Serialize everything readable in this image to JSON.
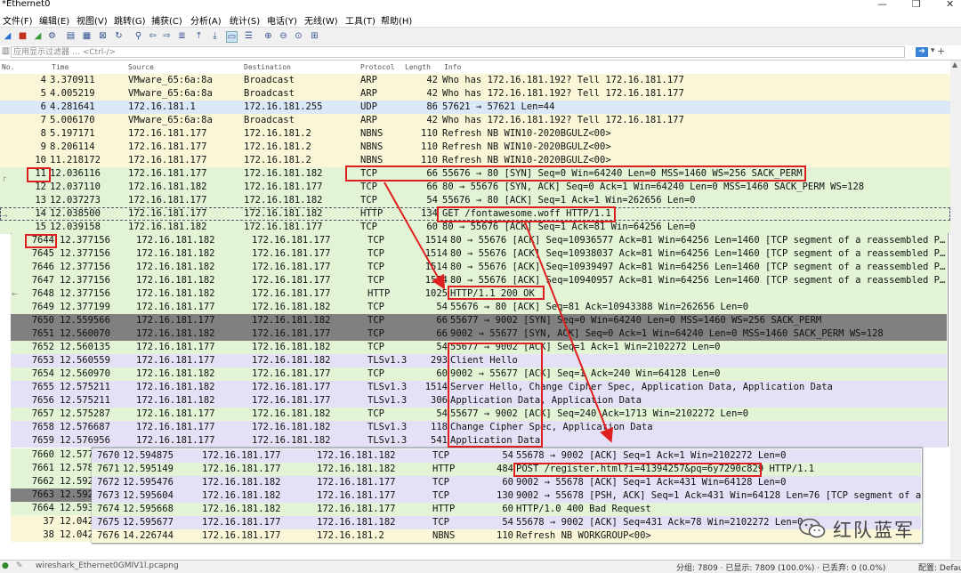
{
  "window": {
    "title": "*Ethernet0"
  },
  "menu": [
    "文件(F)",
    "编辑(E)",
    "视图(V)",
    "跳转(G)",
    "捕获(C)",
    "分析(A)",
    "统计(S)",
    "电话(Y)",
    "无线(W)",
    "工具(T)",
    "帮助(H)"
  ],
  "filter": {
    "placeholder": "应用显示过滤器 … <Ctrl-/>"
  },
  "columns": {
    "no": "No.",
    "time": "Time",
    "src": "Source",
    "dst": "Destination",
    "proto": "Protocol",
    "len": "Length",
    "info": "Info"
  },
  "packets_main": [
    {
      "no": "4",
      "time": "3.370911",
      "src": "VMware_65:6a:8a",
      "dst": "Broadcast",
      "proto": "ARP",
      "len": "42",
      "info": "Who has 172.16.181.192? Tell 172.16.181.177"
    },
    {
      "no": "5",
      "time": "4.005219",
      "src": "VMware_65:6a:8a",
      "dst": "Broadcast",
      "proto": "ARP",
      "len": "42",
      "info": "Who has 172.16.181.192? Tell 172.16.181.177"
    },
    {
      "no": "6",
      "time": "4.281641",
      "src": "172.16.181.1",
      "dst": "172.16.181.255",
      "proto": "UDP",
      "len": "86",
      "info": "57621 → 57621 Len=44"
    },
    {
      "no": "7",
      "time": "5.006170",
      "src": "VMware_65:6a:8a",
      "dst": "Broadcast",
      "proto": "ARP",
      "len": "42",
      "info": "Who has 172.16.181.192? Tell 172.16.181.177"
    },
    {
      "no": "8",
      "time": "5.197171",
      "src": "172.16.181.177",
      "dst": "172.16.181.2",
      "proto": "NBNS",
      "len": "110",
      "info": "Refresh NB WIN10-2020BGULZ<00>"
    },
    {
      "no": "9",
      "time": "8.206114",
      "src": "172.16.181.177",
      "dst": "172.16.181.2",
      "proto": "NBNS",
      "len": "110",
      "info": "Refresh NB WIN10-2020BGULZ<00>"
    },
    {
      "no": "10",
      "time": "11.218172",
      "src": "172.16.181.177",
      "dst": "172.16.181.2",
      "proto": "NBNS",
      "len": "110",
      "info": "Refresh NB WIN10-2020BGULZ<00>"
    },
    {
      "no": "11",
      "time": "12.036116",
      "src": "172.16.181.177",
      "dst": "172.16.181.182",
      "proto": "TCP",
      "len": "66",
      "info": "55676 → 80 [SYN] Seq=0 Win=64240 Len=0 MSS=1460 WS=256 SACK_PERM"
    },
    {
      "no": "12",
      "time": "12.037110",
      "src": "172.16.181.182",
      "dst": "172.16.181.177",
      "proto": "TCP",
      "len": "66",
      "info": "80 → 55676 [SYN, ACK] Seq=0 Ack=1 Win=64240 Len=0 MSS=1460 SACK_PERM WS=128"
    },
    {
      "no": "13",
      "time": "12.037273",
      "src": "172.16.181.177",
      "dst": "172.16.181.182",
      "proto": "TCP",
      "len": "54",
      "info": "55676 → 80 [ACK] Seq=1 Ack=1 Win=262656 Len=0"
    },
    {
      "no": "14",
      "time": "12.038500",
      "src": "172.16.181.177",
      "dst": "172.16.181.182",
      "proto": "HTTP",
      "len": "134",
      "info": "GET /fontawesome.woff HTTP/1.1"
    },
    {
      "no": "15",
      "time": "12.039158",
      "src": "172.16.181.182",
      "dst": "172.16.181.177",
      "proto": "TCP",
      "len": "60",
      "info": "80 → 55676 [ACK] Seq=1 Ack=81 Win=64256 Len=0"
    }
  ],
  "packets_overlay1": [
    {
      "no": "7644",
      "time": "12.377156",
      "src": "172.16.181.182",
      "dst": "172.16.181.177",
      "proto": "TCP",
      "len": "1514",
      "info": "80 → 55676 [ACK] Seq=10936577 Ack=81 Win=64256 Len=1460 [TCP segment of a reassembled P…"
    },
    {
      "no": "7645",
      "time": "12.377156",
      "src": "172.16.181.182",
      "dst": "172.16.181.177",
      "proto": "TCP",
      "len": "1514",
      "info": "80 → 55676 [ACK] Seq=10938037 Ack=81 Win=64256 Len=1460 [TCP segment of a reassembled P…"
    },
    {
      "no": "7646",
      "time": "12.377156",
      "src": "172.16.181.182",
      "dst": "172.16.181.177",
      "proto": "TCP",
      "len": "1514",
      "info": "80 → 55676 [ACK] Seq=10939497 Ack=81 Win=64256 Len=1460 [TCP segment of a reassembled P…"
    },
    {
      "no": "7647",
      "time": "12.377156",
      "src": "172.16.181.182",
      "dst": "172.16.181.177",
      "proto": "TCP",
      "len": "1514",
      "info": "80 → 55676 [ACK] Seq=10940957 Ack=81 Win=64256 Len=1460 [TCP segment of a reassembled P…"
    },
    {
      "no": "7648",
      "time": "12.377156",
      "src": "172.16.181.182",
      "dst": "172.16.181.177",
      "proto": "HTTP",
      "len": "1025",
      "info": "HTTP/1.1 200 OK"
    },
    {
      "no": "7649",
      "time": "12.377199",
      "src": "172.16.181.177",
      "dst": "172.16.181.182",
      "proto": "TCP",
      "len": "54",
      "info": "55676 → 80 [ACK] Seq=81 Ack=10943388 Win=262656 Len=0"
    },
    {
      "no": "7650",
      "time": "12.559566",
      "src": "172.16.181.177",
      "dst": "172.16.181.182",
      "proto": "TCP",
      "len": "66",
      "info": "55677 → 9002 [SYN] Seq=0 Win=64240 Len=0 MSS=1460 WS=256 SACK_PERM"
    },
    {
      "no": "7651",
      "time": "12.560070",
      "src": "172.16.181.182",
      "dst": "172.16.181.177",
      "proto": "TCP",
      "len": "66",
      "info": "9002 → 55677 [SYN, ACK] Seq=0 Ack=1 Win=64240 Len=0 MSS=1460 SACK_PERM WS=128"
    },
    {
      "no": "7652",
      "time": "12.560135",
      "src": "172.16.181.177",
      "dst": "172.16.181.182",
      "proto": "TCP",
      "len": "54",
      "info": "55677 → 9002 [ACK] Seq=1 Ack=1 Win=2102272 Len=0"
    },
    {
      "no": "7653",
      "time": "12.560559",
      "src": "172.16.181.177",
      "dst": "172.16.181.182",
      "proto": "TLSv1.3",
      "len": "293",
      "info": "Client Hello"
    },
    {
      "no": "7654",
      "time": "12.560970",
      "src": "172.16.181.182",
      "dst": "172.16.181.177",
      "proto": "TCP",
      "len": "60",
      "info": "9002 → 55677 [ACK] Seq=1 Ack=240 Win=64128 Len=0"
    },
    {
      "no": "7655",
      "time": "12.575211",
      "src": "172.16.181.182",
      "dst": "172.16.181.177",
      "proto": "TLSv1.3",
      "len": "1514",
      "info": "Server Hello, Change Cipher Spec, Application Data, Application Data"
    },
    {
      "no": "7656",
      "time": "12.575211",
      "src": "172.16.181.182",
      "dst": "172.16.181.177",
      "proto": "TLSv1.3",
      "len": "306",
      "info": "Application Data, Application Data"
    },
    {
      "no": "7657",
      "time": "12.575287",
      "src": "172.16.181.177",
      "dst": "172.16.181.182",
      "proto": "TCP",
      "len": "54",
      "info": "55677 → 9002 [ACK] Seq=240 Ack=1713 Win=2102272 Len=0"
    },
    {
      "no": "7658",
      "time": "12.576687",
      "src": "172.16.181.177",
      "dst": "172.16.181.182",
      "proto": "TLSv1.3",
      "len": "118",
      "info": "Change Cipher Spec, Application Data"
    },
    {
      "no": "7659",
      "time": "12.576956",
      "src": "172.16.181.177",
      "dst": "172.16.181.182",
      "proto": "TLSv1.3",
      "len": "541",
      "info": "Application Data"
    }
  ],
  "packets_left_partial": [
    {
      "no": "7660",
      "time": "12.577"
    },
    {
      "no": "7661",
      "time": "12.578"
    },
    {
      "no": "7662",
      "time": "12.592"
    },
    {
      "no": "7663",
      "time": "12.592"
    },
    {
      "no": "7664",
      "time": "12.593"
    },
    {
      "no": "37",
      "time": "12.0429"
    },
    {
      "no": "38",
      "time": "12.0429"
    }
  ],
  "packets_overlay2": [
    {
      "no": "7670",
      "time": "12.594875",
      "src": "172.16.181.177",
      "dst": "172.16.181.182",
      "proto": "TCP",
      "len": "54",
      "info": "55678 → 9002 [ACK] Seq=1 Ack=1 Win=2102272 Len=0"
    },
    {
      "no": "7671",
      "time": "12.595149",
      "src": "172.16.181.177",
      "dst": "172.16.181.182",
      "proto": "HTTP",
      "len": "484",
      "info": "POST /register.html?i=41394257&pq=6y7290c829 HTTP/1.1"
    },
    {
      "no": "7672",
      "time": "12.595476",
      "src": "172.16.181.182",
      "dst": "172.16.181.177",
      "proto": "TCP",
      "len": "60",
      "info": "9002 → 55678 [ACK] Seq=1 Ack=431 Win=64128 Len=0"
    },
    {
      "no": "7673",
      "time": "12.595604",
      "src": "172.16.181.182",
      "dst": "172.16.181.177",
      "proto": "TCP",
      "len": "130",
      "info": "9002 → 55678 [PSH, ACK] Seq=1 Ack=431 Win=64128 Len=76 [TCP segment of a"
    },
    {
      "no": "7674",
      "time": "12.595668",
      "src": "172.16.181.182",
      "dst": "172.16.181.177",
      "proto": "HTTP",
      "len": "60",
      "info": "HTTP/1.0 400 Bad Request"
    },
    {
      "no": "7675",
      "time": "12.595677",
      "src": "172.16.181.177",
      "dst": "172.16.181.182",
      "proto": "TCP",
      "len": "54",
      "info": "55678 → 9002 [ACK] Seq=431 Ack=78 Win=2102272 Len=0"
    },
    {
      "no": "7676",
      "time": "14.226744",
      "src": "172.16.181.177",
      "dst": "172.16.181.2",
      "proto": "NBNS",
      "len": "110",
      "info": "Refresh NB WORKGROUP<00>"
    }
  ],
  "status": {
    "file": "wireshark_Ethernet0GMIV1l.pcapng",
    "stats": "分组: 7809 · 已显示: 7809 (100.0%) · 已丢弃: 0 (0.0%)",
    "profile": "配置: Default"
  },
  "watermark": {
    "text": "红队蓝军"
  },
  "colors": {
    "arp_nbns": "#faf7d8",
    "udp": "#dbe8f7",
    "tcp_http": "#e2f4d5",
    "tls": "#e4e0f6",
    "gray": "#808080",
    "annotation": "#e02020"
  }
}
